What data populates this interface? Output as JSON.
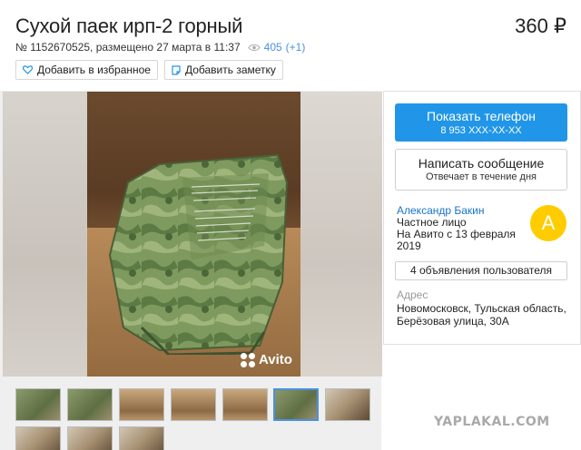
{
  "listing": {
    "title": "Сухой паек ирп-2 горный",
    "price": "360 ₽",
    "number": "№ 1152670525, размещено 27 марта в 11:37",
    "views": "405",
    "views_delta": "(+1)"
  },
  "actions": {
    "favorite_label": "Добавить в избранное",
    "note_label": "Добавить заметку"
  },
  "gallery": {
    "watermark": "Avito",
    "thumbnail_count": 10,
    "active_index": 5
  },
  "contact": {
    "phone_label": "Показать телефон",
    "phone_masked": "8 953 XXX-XX-XX",
    "message_label": "Написать сообщение",
    "message_sub": "Отвечает в течение дня"
  },
  "seller": {
    "name": "Александр Бакин",
    "type": "Частное лицо",
    "since": "На Авито с 13 февраля 2019",
    "avatar_letter": "А",
    "avatar_color": "#ffcc00",
    "ads_label": "4 объявления пользователя"
  },
  "address": {
    "label": "Адрес",
    "value": "Новомосковск, Тульская область, Берёзовая улица, 30А"
  },
  "site_watermark": "YAPLAKAL.COM",
  "colors": {
    "accent": "#2196e8",
    "link": "#1a73c9"
  }
}
